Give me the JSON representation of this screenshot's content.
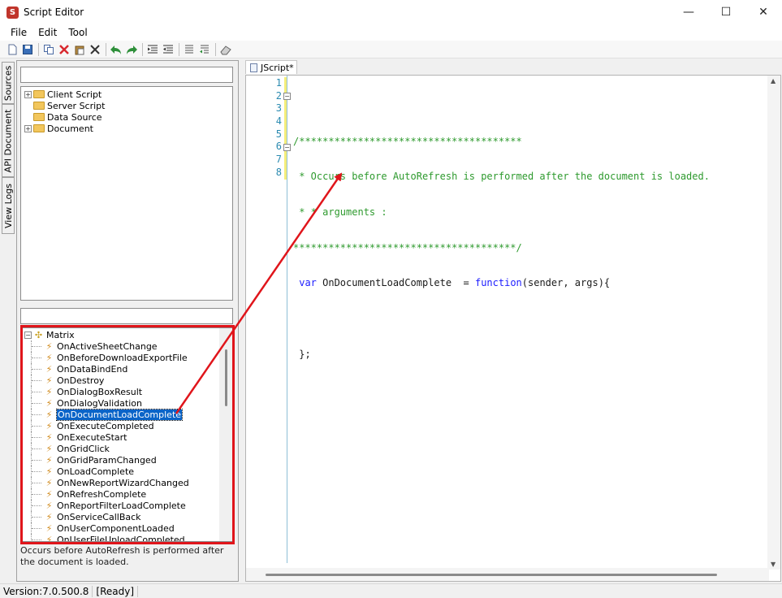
{
  "window": {
    "title": "Script Editor",
    "icon_letter": "S",
    "buttons": {
      "minimize": "—",
      "maximize": "☐",
      "close": "✕"
    }
  },
  "menu": [
    "File",
    "Edit",
    "Tool"
  ],
  "toolbar_icons": [
    "new-document-icon",
    "save-icon",
    "copy-icon",
    "cut-icon",
    "paste-icon",
    "delete-icon",
    "undo-icon",
    "redo-icon",
    "indent-icon",
    "outdent-icon",
    "comment-icon",
    "uncomment-icon",
    "eraser-icon"
  ],
  "side_tabs": [
    "Sources",
    "API Document",
    "View Logs"
  ],
  "source_tree": [
    {
      "label": "Client Script",
      "expandable": true
    },
    {
      "label": "Server Script",
      "expandable": false
    },
    {
      "label": "Data Source",
      "expandable": false
    },
    {
      "label": "Document",
      "expandable": true
    }
  ],
  "event_tree": {
    "root": "Matrix",
    "items": [
      "OnActiveSheetChange",
      "OnBeforeDownloadExportFile",
      "OnDataBindEnd",
      "OnDestroy",
      "OnDialogBoxResult",
      "OnDialogValidation",
      "OnDocumentLoadComplete",
      "OnExecuteCompleted",
      "OnExecuteStart",
      "OnGridClick",
      "OnGridParamChanged",
      "OnLoadComplete",
      "OnNewReportWizardChanged",
      "OnRefreshComplete",
      "OnReportFilterLoadComplete",
      "OnServiceCallBack",
      "OnUserComponentLoaded",
      "OnUserFileUploadCompleted"
    ],
    "selected": "OnDocumentLoadComplete"
  },
  "description": "Occurs before AutoRefresh is performed after the document is loaded.",
  "editor": {
    "tab_label": "JScript*",
    "line_numbers": [
      "1",
      "2",
      "3",
      "4",
      "5",
      "6",
      "7",
      "8"
    ],
    "lines": [
      "",
      "/**************************************",
      " * Occurs before AutoRefresh is performed after the document is loaded.",
      " * * arguments :",
      "**************************************/",
      " var",
      " OnDocumentLoadComplete  = ",
      "function",
      "(sender, args){",
      "",
      " };"
    ]
  },
  "status": {
    "version": "Version:7.0.500.8",
    "state": "[Ready]"
  },
  "colors": {
    "highlight_box": "#e0151b",
    "selection": "#0a64c8",
    "comment": "#2e9a2e",
    "keyword": "#1c1cff"
  }
}
